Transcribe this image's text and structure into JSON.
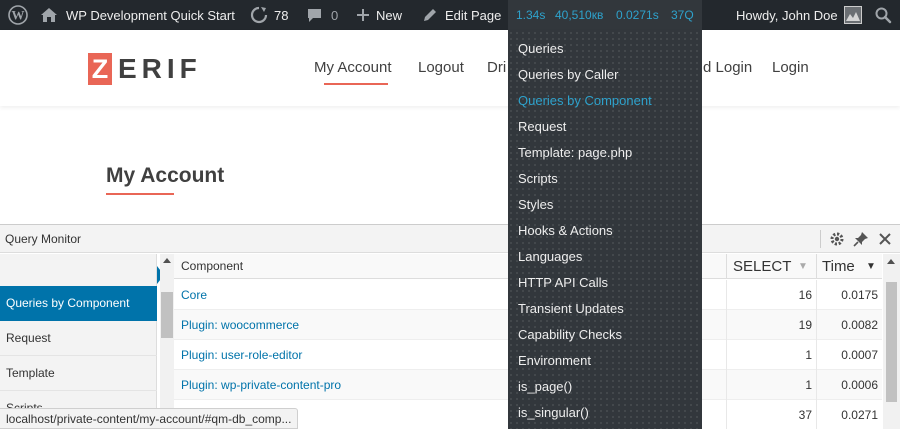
{
  "admin_bar": {
    "site_name": "WP Development Quick Start",
    "updates_count": "78",
    "comments_count": "0",
    "new_label": "New",
    "edit_label": "Edit Page",
    "qm_time": "1.34s",
    "qm_memory": "40,510кв",
    "qm_db_time": "0.0271s",
    "qm_queries": "37Q",
    "greeting": "Howdy, John Doe"
  },
  "site": {
    "logo_first": "Z",
    "logo_rest": "ERIF",
    "nav": [
      "My Account",
      "Logout",
      "Dri",
      "d Login",
      "Login"
    ],
    "page_title": "My Account"
  },
  "query_monitor": {
    "title": "Query Monitor",
    "sidebar": [
      "Queries by Component",
      "Request",
      "Template",
      "Scripts"
    ],
    "columns": {
      "component": "Component",
      "select": "SELECT",
      "time": "Time"
    },
    "rows": [
      {
        "component": "Core",
        "select": "16",
        "time": "0.0175"
      },
      {
        "component": "Plugin: woocommerce",
        "select": "19",
        "time": "0.0082"
      },
      {
        "component": "Plugin: user-role-editor",
        "select": "1",
        "time": "0.0007"
      },
      {
        "component": "Plugin: wp-private-content-pro",
        "select": "1",
        "time": "0.0006"
      },
      {
        "component": "",
        "select": "37",
        "time": "0.0271"
      }
    ]
  },
  "status_url": "localhost/private-content/my-account/#qm-db_comp...",
  "dropdown": [
    "Queries",
    "Queries by Caller",
    "Queries by Component",
    "Request",
    "Template: page.php",
    "Scripts",
    "Styles",
    "Hooks & Actions",
    "Languages",
    "HTTP API Calls",
    "Transient Updates",
    "Capability Checks",
    "Environment",
    "is_page()",
    "is_singular()"
  ],
  "colors": {
    "adminbar": "#23282d",
    "accent": "#e96656",
    "wp_blue": "#0073aa",
    "qm_highlight": "#2ea2cc"
  }
}
